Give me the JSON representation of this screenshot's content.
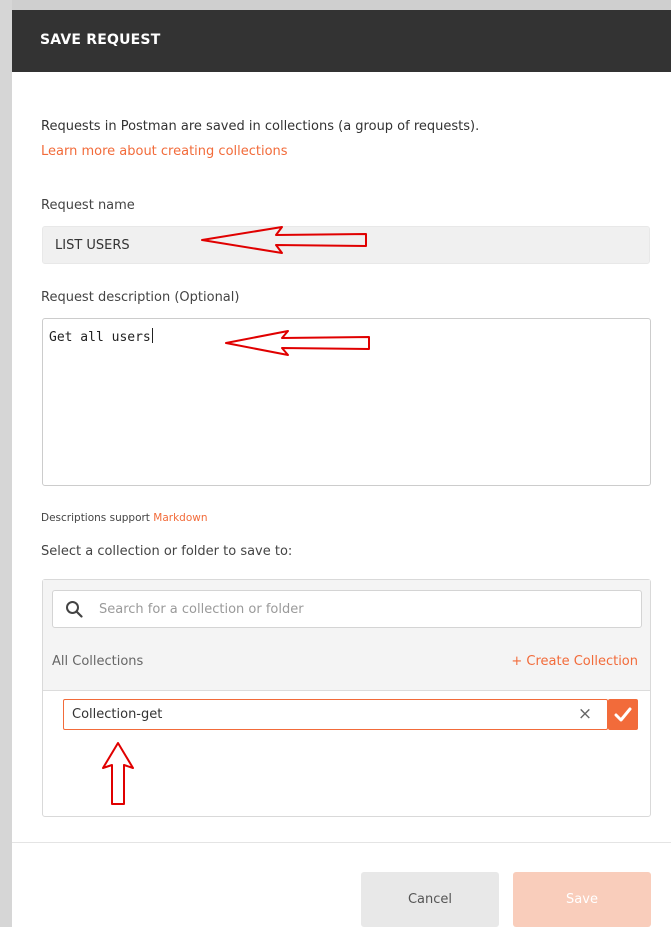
{
  "modal": {
    "title": "SAVE REQUEST",
    "intro": "Requests in Postman are saved in collections (a group of requests).",
    "learn_link": "Learn more about creating collections"
  },
  "request_name": {
    "label": "Request name",
    "value": "LIST USERS"
  },
  "request_description": {
    "label": "Request description (Optional)",
    "value": "Get all users"
  },
  "markdown_note": {
    "prefix": "Descriptions support ",
    "link": "Markdown"
  },
  "collection_picker": {
    "label": "Select a collection or folder to save to:",
    "search_placeholder": "Search for a collection or folder",
    "all_collections": "All Collections",
    "create_collection": "+ Create Collection",
    "new_collection_value": "Collection-get",
    "clear_symbol": "×"
  },
  "footer": {
    "cancel": "Cancel",
    "save": "Save"
  },
  "colors": {
    "accent": "#f26b3a",
    "header": "#333333",
    "annotation_arrow": "#e00000"
  },
  "icons": [
    "search-icon",
    "close-icon",
    "check-icon",
    "red-arrow-annotation"
  ]
}
